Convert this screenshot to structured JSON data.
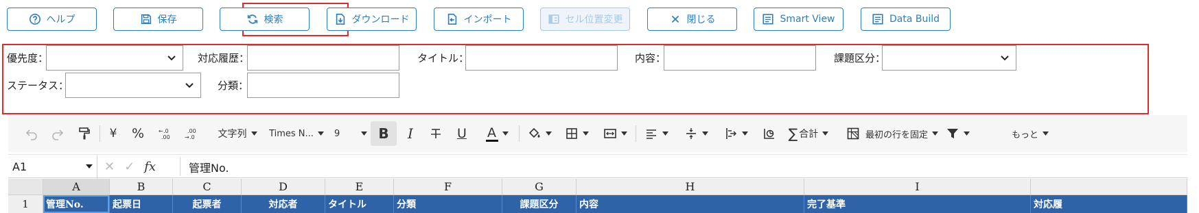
{
  "topbar": {
    "buttons": [
      {
        "label": "ヘルプ",
        "icon": "help-circle-icon"
      },
      {
        "label": "保存",
        "icon": "save-icon"
      },
      {
        "label": "検索",
        "icon": "refresh-icon"
      },
      {
        "label": "ダウンロード",
        "icon": "download-icon"
      },
      {
        "label": "インポート",
        "icon": "import-icon"
      },
      {
        "label": "セル位置変更",
        "icon": "columns-icon",
        "disabled": true
      },
      {
        "label": "閉じる",
        "icon": "close-icon"
      },
      {
        "label": "Smart View",
        "icon": "list-icon"
      },
      {
        "label": "Data Build",
        "icon": "list-icon"
      }
    ]
  },
  "filters": {
    "priority_label": "優先度：",
    "history_label": "対応履歴：",
    "title_label": "タイトル：",
    "content_label": "内容：",
    "category_label": "課題区分：",
    "status_label": "ステータス：",
    "class_label": "分類：",
    "priority_value": "",
    "history_value": "",
    "title_value": "",
    "content_value": "",
    "category_value": "",
    "status_value": "",
    "class_value": ""
  },
  "toolbar": {
    "yen": "¥",
    "percent": "%",
    "format": "文字列",
    "font": "Times N...",
    "size": "9",
    "bold": "B",
    "italic": "I",
    "underline": "U",
    "font_color": "A",
    "sum": "合計",
    "freeze": "最初の行を固定",
    "more": "もっと"
  },
  "formula_bar": {
    "cell_ref": "A1",
    "fx": "fx",
    "content": "管理No."
  },
  "grid": {
    "columns": [
      "A",
      "B",
      "C",
      "D",
      "E",
      "F",
      "G",
      "H",
      "I"
    ],
    "row_number": "1",
    "headers": [
      "管理No.",
      "起票日",
      "起票者",
      "対応者",
      "タイトル",
      "分類",
      "課題区分",
      "内容",
      "完了基準",
      "対応履"
    ]
  },
  "colors": {
    "accent": "#2b7fc0",
    "highlight_border": "#e12a2a",
    "header_fill": "#2e63a8"
  }
}
